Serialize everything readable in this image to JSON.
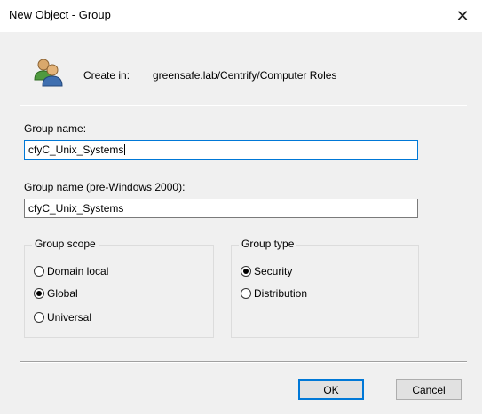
{
  "window": {
    "title": "New Object - Group",
    "close_glyph": "✕"
  },
  "create_in": {
    "label": "Create in:",
    "path": "greensafe.lab/Centrify/Computer Roles",
    "icon": "group-users-icon"
  },
  "group_name": {
    "label": "Group name:",
    "value": "cfyC_Unix_Systems"
  },
  "group_name_pre2000": {
    "label": "Group name (pre-Windows 2000):",
    "value": "cfyC_Unix_Systems"
  },
  "group_scope": {
    "title": "Group scope",
    "options": [
      {
        "label": "Domain local",
        "checked": false
      },
      {
        "label": "Global",
        "checked": true
      },
      {
        "label": "Universal",
        "checked": false
      }
    ]
  },
  "group_type": {
    "title": "Group type",
    "options": [
      {
        "label": "Security",
        "checked": true
      },
      {
        "label": "Distribution",
        "checked": false
      }
    ]
  },
  "buttons": {
    "ok": "OK",
    "cancel": "Cancel"
  },
  "colors": {
    "focus_accent": "#0078d7",
    "background": "#f0f0f0",
    "titlebar": "#ffffff"
  }
}
